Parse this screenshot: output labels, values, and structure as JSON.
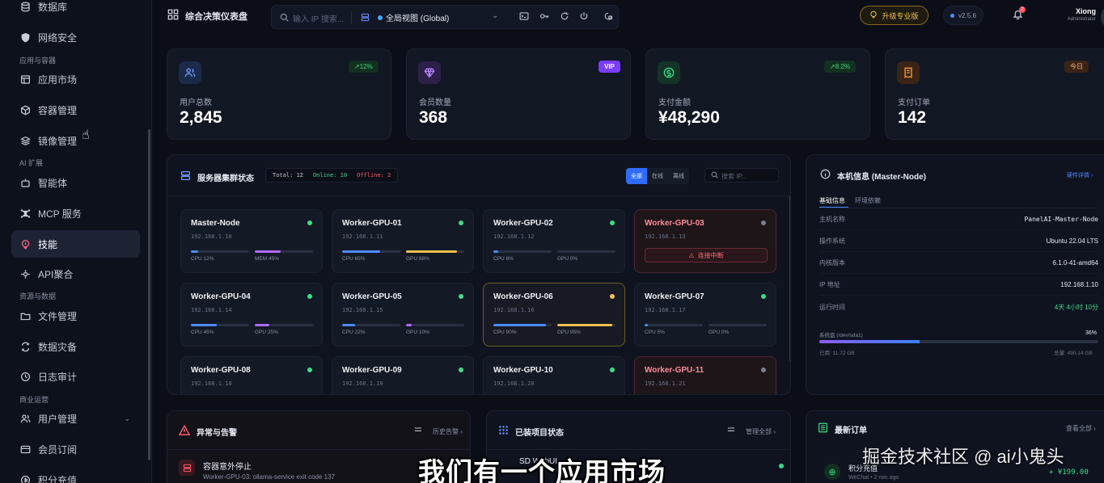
{
  "sidebar": {
    "items": [
      {
        "label": "数据库",
        "icon": "database-icon"
      },
      {
        "label": "网络安全",
        "icon": "shield-icon"
      },
      {
        "label": "应用市场",
        "icon": "store-icon"
      },
      {
        "label": "容器管理",
        "icon": "box-icon"
      },
      {
        "label": "镜像管理",
        "icon": "layers-icon"
      },
      {
        "label": "智能体",
        "icon": "bot-icon"
      },
      {
        "label": "MCP 服务",
        "icon": "network-icon"
      },
      {
        "label": "技能",
        "icon": "skill-icon"
      },
      {
        "label": "API聚合",
        "icon": "api-icon"
      },
      {
        "label": "文件管理",
        "icon": "folder-icon"
      },
      {
        "label": "数据灾备",
        "icon": "backup-icon"
      },
      {
        "label": "日志审计",
        "icon": "history-icon"
      },
      {
        "label": "用户管理",
        "icon": "users-icon"
      },
      {
        "label": "会员订阅",
        "icon": "card-icon"
      },
      {
        "label": "积分充值",
        "icon": "coin-icon"
      }
    ],
    "sections": [
      "应用与容器",
      "AI 扩展",
      "资源与数据",
      "商业运营"
    ]
  },
  "topbar": {
    "title": "综合决策仪表盘",
    "search_placeholder": "输入 IP 搜索...",
    "scope": "全局视图 (Global)",
    "upgrade_label": "升级专业版",
    "version": "v2.5.6",
    "bell_count": "2",
    "user_name": "Xiong",
    "user_role": "Administrator"
  },
  "stats": [
    {
      "label": "用户总数",
      "value": "2,845",
      "badge": "↗12%",
      "color": "#4d8bff"
    },
    {
      "label": "会员数量",
      "value": "368",
      "badge": "VIP",
      "color": "#b06bff"
    },
    {
      "label": "支付金额",
      "value": "¥48,290",
      "badge": "↗8.2%",
      "color": "#2ecc71"
    },
    {
      "label": "支付订单",
      "value": "142",
      "badge": "今日",
      "color": "#ff9a3c"
    }
  ],
  "cluster": {
    "title": "服务器集群状态",
    "total": "Total: 12",
    "online": "Online: 10",
    "offline": "Offline: 2",
    "filters": [
      "全部",
      "在线",
      "离线"
    ],
    "search_placeholder": "搜索 IP...",
    "disconnect_label": "连接中断",
    "nodes": [
      {
        "name": "Master-Node",
        "ip": "192.168.1.10",
        "status": "online",
        "l1": "CPU 12%",
        "v1": 12,
        "l2": "MEM 45%",
        "v2": 45
      },
      {
        "name": "Worker-GPU-01",
        "ip": "192.168.1.11",
        "status": "online",
        "l1": "CPU 65%",
        "v1": 65,
        "l2": "GPU 88%",
        "v2": 88
      },
      {
        "name": "Worker-GPU-02",
        "ip": "192.168.1.12",
        "status": "online",
        "l1": "CPU 8%",
        "v1": 8,
        "l2": "GPU 0%",
        "v2": 0
      },
      {
        "name": "Worker-GPU-03",
        "ip": "192.168.1.13",
        "status": "offline"
      },
      {
        "name": "Worker-GPU-04",
        "ip": "192.168.1.14",
        "status": "online",
        "l1": "CPU 45%",
        "v1": 45,
        "l2": "GPU 25%",
        "v2": 25
      },
      {
        "name": "Worker-GPU-05",
        "ip": "192.168.1.15",
        "status": "online",
        "l1": "CPU 22%",
        "v1": 22,
        "l2": "GPU 10%",
        "v2": 10
      },
      {
        "name": "Worker-GPU-06",
        "ip": "192.168.1.16",
        "status": "warn",
        "l1": "CPU 90%",
        "v1": 90,
        "l2": "GPU 95%",
        "v2": 95
      },
      {
        "name": "Worker-GPU-07",
        "ip": "192.168.1.17",
        "status": "online",
        "l1": "CPU 5%",
        "v1": 5,
        "l2": "GPU 0%",
        "v2": 0
      },
      {
        "name": "Worker-GPU-08",
        "ip": "192.168.1.18",
        "status": "online"
      },
      {
        "name": "Worker-GPU-09",
        "ip": "192.168.1.19",
        "status": "online"
      },
      {
        "name": "Worker-GPU-10",
        "ip": "192.168.1.20",
        "status": "online"
      },
      {
        "name": "Worker-GPU-11",
        "ip": "192.168.1.21",
        "status": "offline"
      }
    ]
  },
  "machine": {
    "title": "本机信息 (Master-Node)",
    "link": "硬件详情 ›",
    "tabs": [
      "基础信息",
      "环境依赖"
    ],
    "rows": [
      {
        "k": "主机名称",
        "v": "PanelAI-Master-Node"
      },
      {
        "k": "操作系统",
        "v": "Ubuntu 22.04 LTS"
      },
      {
        "k": "内核版本",
        "v": "6.1.0-41-amd64"
      },
      {
        "k": "IP 地址",
        "v": "192.168.1.10"
      },
      {
        "k": "运行时间",
        "v": "4天 4小时 10分"
      }
    ],
    "disk_label": "系统盘 (/dev/sda1)",
    "disk_pct": "36%",
    "disk_value": 36,
    "disk_used": "已用: 11.72 GB",
    "disk_total": "总量: 490.14 GB"
  },
  "alerts": {
    "title": "异常与告警",
    "link": "历史告警 ›",
    "item_title": "容器意外停止",
    "item_desc": "Worker-GPU-03: ollama-service exit code 137"
  },
  "projects": {
    "title": "已装项目状态",
    "link": "管理全部 ›",
    "item": "SD WebUI"
  },
  "orders": {
    "title": "最新订单",
    "link": "查看全部 ›",
    "item_title": "积分充值",
    "item_meta": "WeChat • 2 min ago",
    "item_amount": "+ ¥199.00"
  },
  "overlay": {
    "subtitle": "我们有一个应用市场",
    "watermark": "掘金技术社区 @ ai小鬼头"
  }
}
